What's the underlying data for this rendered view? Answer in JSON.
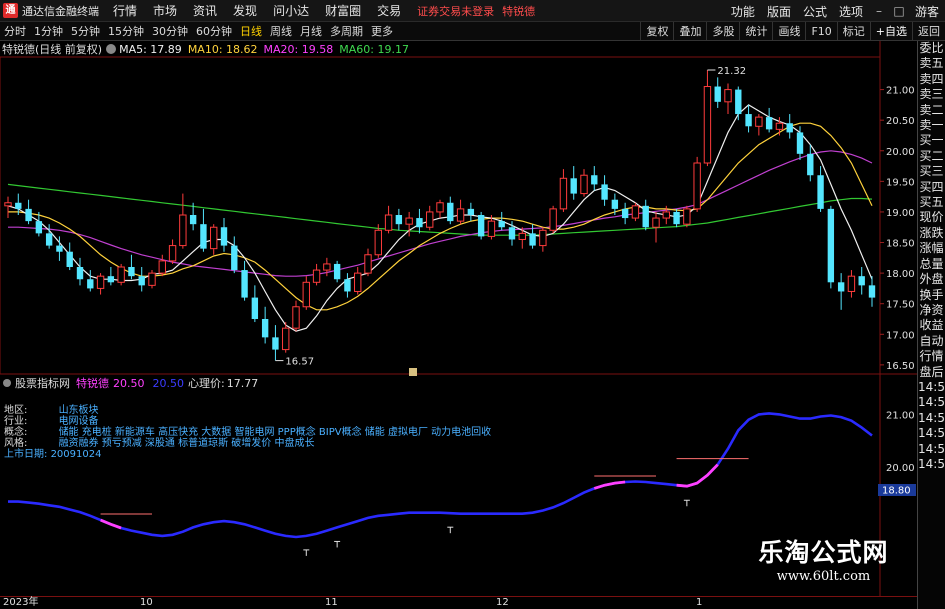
{
  "app": {
    "logo_glyph": "通",
    "title": "通达信金融终端"
  },
  "menu": {
    "items": [
      "行情",
      "市场",
      "资讯",
      "发现",
      "问小达",
      "财富圈",
      "交易"
    ],
    "login_status": "证券交易未登录",
    "user": "特锐德",
    "right": [
      "功能",
      "版面",
      "公式",
      "选项",
      "游客"
    ]
  },
  "periods": {
    "tabs": [
      "分时",
      "1分钟",
      "5分钟",
      "15分钟",
      "30分钟",
      "60分钟",
      "日线",
      "周线",
      "月线",
      "多周期",
      "更多"
    ],
    "active": "日线"
  },
  "toolbar": [
    "复权",
    "叠加",
    "多股",
    "统计",
    "画线",
    "F10",
    "标记",
    "+自选",
    "返回"
  ],
  "legend": {
    "stock": "特锐德(日线 前复权)",
    "ma": [
      {
        "label": "MA5: 17.89",
        "color": "#f0f0f0"
      },
      {
        "label": "MA10: 18.62",
        "color": "#ffd23c"
      },
      {
        "label": "MA20: 19.58",
        "color": "#ff40ff"
      },
      {
        "label": "MA60: 19.17",
        "color": "#3fd94f"
      }
    ]
  },
  "price_axis": {
    "labels": [
      "21.00",
      "20.50",
      "20.00",
      "19.50",
      "19.00",
      "18.50",
      "18.00",
      "17.50",
      "17.00",
      "16.50"
    ]
  },
  "annotations": {
    "high": "21.32",
    "low": "16.57"
  },
  "colors": {
    "up": "#ff3c3c",
    "down": "#54e6ff",
    "ma5": "#f0f0f0",
    "ma10": "#ffd23c",
    "ma20": "#c040d0",
    "ma60": "#32c832"
  },
  "indicator": {
    "name": "股票指标网",
    "series1_label": "特锐德",
    "series1_value": "20.50",
    "series2_value": "20.50",
    "series3_label": "心理价:",
    "series3_value": "17.77",
    "axis_labels": [
      "21.00",
      "20.00"
    ],
    "current_value": "18.80"
  },
  "info": {
    "region_label": "地区:",
    "region_value": "山东板块",
    "industry_label": "行业:",
    "industry_value": "电网设备",
    "concepts_label": "概念:",
    "concepts_value": "储能 充电桩 新能源车 高压快充 大数据 智能电网 PPP概念 BIPV概念 储能 虚拟电厂 动力电池回收",
    "style_label": "风格:",
    "style_value": "融资融券 预亏预减 深股通 标普道琼斯 破增发价 中盘成长",
    "list_label": "上市日期:",
    "list_value": "20091024"
  },
  "dates": [
    "2023年",
    "10",
    "11",
    "12",
    "1"
  ],
  "right_panel": [
    "委比",
    "卖五",
    "卖四",
    "卖三",
    "卖二",
    "卖一",
    "买一",
    "买二",
    "买三",
    "买四",
    "买五",
    "现价",
    "涨跌",
    "涨幅",
    "总量",
    "外盘",
    "换手",
    "净资",
    "收益",
    "自动",
    "行情",
    "盘后",
    "14:50",
    "14:50",
    "14:50",
    "14:50",
    "14:50",
    "14:50"
  ],
  "watermark": {
    "title": "乐淘公式网",
    "url": "www.60lt.com"
  },
  "chart_data": {
    "type": "candlestick",
    "title": "特锐德(日线 前复权)",
    "y_range": [
      16.4,
      21.5
    ],
    "candles": [
      [
        19.1,
        19.25,
        18.9,
        19.15
      ],
      [
        19.15,
        19.3,
        18.95,
        19.05
      ],
      [
        19.05,
        19.2,
        18.8,
        18.85
      ],
      [
        18.85,
        19.0,
        18.6,
        18.65
      ],
      [
        18.65,
        18.8,
        18.4,
        18.45
      ],
      [
        18.45,
        18.6,
        18.2,
        18.35
      ],
      [
        18.35,
        18.5,
        18.05,
        18.1
      ],
      [
        18.1,
        18.25,
        17.8,
        17.9
      ],
      [
        17.9,
        18.05,
        17.7,
        17.75
      ],
      [
        17.75,
        18.0,
        17.65,
        17.95
      ],
      [
        17.95,
        18.1,
        17.8,
        17.85
      ],
      [
        17.85,
        18.15,
        17.8,
        18.1
      ],
      [
        18.1,
        18.3,
        17.9,
        17.95
      ],
      [
        17.95,
        18.1,
        17.7,
        17.8
      ],
      [
        17.8,
        18.05,
        17.75,
        18.0
      ],
      [
        18.0,
        18.3,
        17.95,
        18.2
      ],
      [
        18.2,
        18.55,
        18.15,
        18.45
      ],
      [
        18.45,
        19.3,
        18.4,
        18.95
      ],
      [
        18.95,
        19.15,
        18.7,
        18.8
      ],
      [
        18.8,
        19.05,
        18.35,
        18.4
      ],
      [
        18.4,
        18.8,
        18.3,
        18.75
      ],
      [
        18.75,
        18.9,
        18.35,
        18.45
      ],
      [
        18.45,
        18.6,
        18.0,
        18.05
      ],
      [
        18.05,
        18.2,
        17.55,
        17.6
      ],
      [
        17.6,
        17.8,
        17.2,
        17.25
      ],
      [
        17.25,
        17.45,
        16.85,
        16.95
      ],
      [
        16.95,
        17.15,
        16.57,
        16.75
      ],
      [
        16.75,
        17.2,
        16.7,
        17.1
      ],
      [
        17.1,
        17.55,
        17.05,
        17.45
      ],
      [
        17.45,
        17.95,
        17.4,
        17.85
      ],
      [
        17.85,
        18.15,
        17.8,
        18.05
      ],
      [
        18.05,
        18.25,
        17.95,
        18.15
      ],
      [
        18.15,
        18.2,
        17.85,
        17.9
      ],
      [
        17.9,
        18.0,
        17.6,
        17.7
      ],
      [
        17.7,
        18.1,
        17.65,
        18.0
      ],
      [
        18.0,
        18.4,
        17.95,
        18.3
      ],
      [
        18.3,
        18.8,
        18.25,
        18.7
      ],
      [
        18.7,
        19.1,
        18.65,
        18.95
      ],
      [
        18.95,
        19.05,
        18.7,
        18.8
      ],
      [
        18.8,
        19.0,
        18.6,
        18.9
      ],
      [
        18.9,
        19.05,
        18.65,
        18.75
      ],
      [
        18.75,
        19.1,
        18.7,
        19.0
      ],
      [
        19.0,
        19.2,
        18.9,
        19.15
      ],
      [
        19.15,
        19.25,
        18.8,
        18.85
      ],
      [
        18.85,
        19.2,
        18.8,
        19.05
      ],
      [
        19.05,
        19.15,
        18.85,
        18.95
      ],
      [
        18.95,
        19.0,
        18.55,
        18.6
      ],
      [
        18.6,
        18.95,
        18.55,
        18.85
      ],
      [
        18.85,
        19.0,
        18.7,
        18.75
      ],
      [
        18.75,
        18.85,
        18.45,
        18.55
      ],
      [
        18.55,
        18.75,
        18.4,
        18.65
      ],
      [
        18.65,
        18.8,
        18.4,
        18.45
      ],
      [
        18.45,
        18.75,
        18.35,
        18.7
      ],
      [
        18.7,
        19.1,
        18.65,
        19.05
      ],
      [
        19.05,
        19.7,
        19.0,
        19.55
      ],
      [
        19.55,
        19.75,
        19.2,
        19.3
      ],
      [
        19.3,
        19.7,
        19.25,
        19.6
      ],
      [
        19.6,
        19.75,
        19.35,
        19.45
      ],
      [
        19.45,
        19.6,
        19.1,
        19.2
      ],
      [
        19.2,
        19.3,
        18.95,
        19.05
      ],
      [
        19.05,
        19.15,
        18.8,
        18.9
      ],
      [
        18.9,
        19.15,
        18.85,
        19.1
      ],
      [
        19.1,
        19.2,
        18.7,
        18.75
      ],
      [
        18.75,
        19.0,
        18.5,
        18.9
      ],
      [
        18.9,
        19.1,
        18.8,
        19.0
      ],
      [
        19.0,
        19.05,
        18.75,
        18.8
      ],
      [
        18.8,
        19.1,
        18.75,
        19.05
      ],
      [
        19.05,
        19.9,
        19.0,
        19.8
      ],
      [
        19.8,
        21.32,
        19.75,
        21.05
      ],
      [
        21.05,
        21.2,
        20.7,
        20.8
      ],
      [
        20.8,
        21.1,
        20.6,
        21.0
      ],
      [
        21.0,
        21.05,
        20.5,
        20.6
      ],
      [
        20.6,
        20.75,
        20.3,
        20.4
      ],
      [
        20.4,
        20.6,
        20.25,
        20.55
      ],
      [
        20.55,
        20.7,
        20.3,
        20.35
      ],
      [
        20.35,
        20.55,
        20.25,
        20.45
      ],
      [
        20.45,
        20.6,
        20.2,
        20.3
      ],
      [
        20.3,
        20.4,
        19.85,
        19.95
      ],
      [
        19.95,
        20.1,
        19.5,
        19.6
      ],
      [
        19.6,
        19.75,
        19.0,
        19.05
      ],
      [
        19.05,
        19.1,
        17.75,
        17.85
      ],
      [
        17.85,
        18.0,
        17.4,
        17.7
      ],
      [
        17.7,
        18.05,
        17.6,
        17.95
      ],
      [
        17.95,
        18.1,
        17.65,
        17.8
      ],
      [
        17.8,
        17.95,
        17.45,
        17.6
      ]
    ],
    "ma5": [
      19.1,
      19.05,
      18.95,
      18.85,
      18.7,
      18.5,
      18.3,
      18.1,
      17.95,
      17.9,
      17.9,
      17.88,
      17.88,
      17.9,
      17.98,
      18.0,
      18.05,
      18.2,
      18.35,
      18.5,
      18.55,
      18.55,
      18.45,
      18.25,
      18.0,
      17.7,
      17.4,
      17.15,
      17.05,
      17.1,
      17.3,
      17.55,
      17.75,
      17.9,
      17.95,
      18.0,
      18.15,
      18.35,
      18.55,
      18.7,
      18.8,
      18.85,
      18.9,
      18.92,
      18.95,
      18.95,
      18.92,
      18.9,
      18.85,
      18.78,
      18.7,
      18.62,
      18.6,
      18.65,
      18.8,
      19.0,
      19.2,
      19.35,
      19.4,
      19.35,
      19.25,
      19.15,
      19.02,
      18.98,
      18.95,
      18.92,
      18.95,
      19.1,
      19.5,
      19.9,
      20.3,
      20.6,
      20.75,
      20.65,
      20.55,
      20.48,
      20.42,
      20.3,
      20.1,
      19.85,
      19.45,
      19.05,
      18.7,
      18.3,
      17.9
    ],
    "ma10": [
      19.0,
      19.0,
      18.98,
      18.95,
      18.9,
      18.82,
      18.72,
      18.6,
      18.45,
      18.3,
      18.18,
      18.08,
      18.0,
      17.95,
      17.95,
      17.97,
      18.0,
      18.07,
      18.12,
      18.2,
      18.28,
      18.32,
      18.3,
      18.25,
      18.18,
      18.05,
      17.9,
      17.75,
      17.6,
      17.48,
      17.4,
      17.4,
      17.45,
      17.52,
      17.62,
      17.75,
      17.9,
      18.05,
      18.2,
      18.32,
      18.45,
      18.55,
      18.65,
      18.73,
      18.8,
      18.85,
      18.88,
      18.9,
      18.9,
      18.88,
      18.85,
      18.8,
      18.75,
      18.72,
      18.72,
      18.75,
      18.8,
      18.88,
      18.95,
      19.0,
      19.05,
      19.08,
      19.08,
      19.05,
      19.05,
      19.03,
      19.02,
      19.05,
      19.2,
      19.4,
      19.6,
      19.8,
      19.95,
      20.1,
      20.2,
      20.3,
      20.4,
      20.45,
      20.45,
      20.4,
      20.25,
      20.05,
      19.8,
      19.45,
      19.1
    ],
    "ma20": [
      18.75,
      18.75,
      18.74,
      18.73,
      18.72,
      18.7,
      18.67,
      18.63,
      18.58,
      18.52,
      18.46,
      18.4,
      18.35,
      18.3,
      18.26,
      18.22,
      18.18,
      18.15,
      18.12,
      18.1,
      18.08,
      18.06,
      18.04,
      18.02,
      18.0,
      17.98,
      17.96,
      17.95,
      17.95,
      17.96,
      17.98,
      18.01,
      18.05,
      18.09,
      18.13,
      18.18,
      18.23,
      18.28,
      18.33,
      18.38,
      18.43,
      18.48,
      18.52,
      18.56,
      18.6,
      18.63,
      18.66,
      18.68,
      18.7,
      18.71,
      18.72,
      18.73,
      18.74,
      18.76,
      18.78,
      18.81,
      18.84,
      18.87,
      18.9,
      18.92,
      18.95,
      18.97,
      18.99,
      19.01,
      19.03,
      19.05,
      19.08,
      19.12,
      19.2,
      19.28,
      19.36,
      19.44,
      19.52,
      19.6,
      19.68,
      19.75,
      19.82,
      19.88,
      19.94,
      19.98,
      20.0,
      19.98,
      19.94,
      19.88,
      19.8
    ],
    "ma60": [
      19.45,
      19.43,
      19.41,
      19.39,
      19.37,
      19.35,
      19.33,
      19.31,
      19.29,
      19.27,
      19.25,
      19.23,
      19.21,
      19.19,
      19.17,
      19.15,
      19.13,
      19.11,
      19.09,
      19.07,
      19.05,
      19.03,
      19.01,
      18.99,
      18.97,
      18.95,
      18.93,
      18.91,
      18.89,
      18.87,
      18.85,
      18.83,
      18.81,
      18.79,
      18.77,
      18.75,
      18.73,
      18.72,
      18.7,
      18.69,
      18.68,
      18.67,
      18.66,
      18.65,
      18.64,
      18.63,
      18.62,
      18.62,
      18.62,
      18.62,
      18.62,
      18.62,
      18.63,
      18.64,
      18.65,
      18.66,
      18.67,
      18.68,
      18.69,
      18.7,
      18.71,
      18.72,
      18.73,
      18.74,
      18.75,
      18.76,
      18.78,
      18.8,
      18.82,
      18.85,
      18.88,
      18.91,
      18.94,
      18.97,
      19.0,
      19.03,
      19.06,
      19.09,
      19.12,
      19.15,
      19.18,
      19.2,
      19.22,
      19.22,
      19.21
    ],
    "indicator_line": {
      "y_range": [
        17.6,
        21.5
      ],
      "values": [
        19.35,
        19.35,
        19.33,
        19.31,
        19.28,
        19.25,
        19.2,
        19.15,
        19.08,
        19.0,
        18.92,
        18.85,
        18.8,
        18.76,
        18.72,
        18.7,
        18.72,
        18.78,
        18.86,
        18.92,
        18.96,
        18.98,
        18.96,
        18.92,
        18.86,
        18.8,
        18.74,
        18.7,
        18.68,
        18.7,
        18.74,
        18.8,
        18.86,
        18.92,
        18.98,
        19.04,
        19.08,
        19.1,
        19.12,
        19.14,
        19.14,
        19.14,
        19.14,
        19.13,
        19.12,
        19.12,
        19.12,
        19.12,
        19.12,
        19.12,
        19.12,
        19.14,
        19.18,
        19.24,
        19.32,
        19.42,
        19.52,
        19.6,
        19.66,
        19.7,
        19.72,
        19.73,
        19.72,
        19.7,
        19.68,
        19.66,
        19.64,
        19.7,
        19.85,
        20.05,
        20.35,
        20.7,
        20.9,
        21.0,
        21.02,
        21.0,
        20.96,
        20.92,
        20.92,
        20.96,
        20.98,
        20.95,
        20.88,
        20.75,
        20.6
      ],
      "highlight_ranges": [
        [
          9,
          11
        ],
        [
          57,
          60
        ],
        [
          65,
          69
        ]
      ],
      "t_marks": [
        29,
        32,
        43,
        66
      ]
    }
  }
}
